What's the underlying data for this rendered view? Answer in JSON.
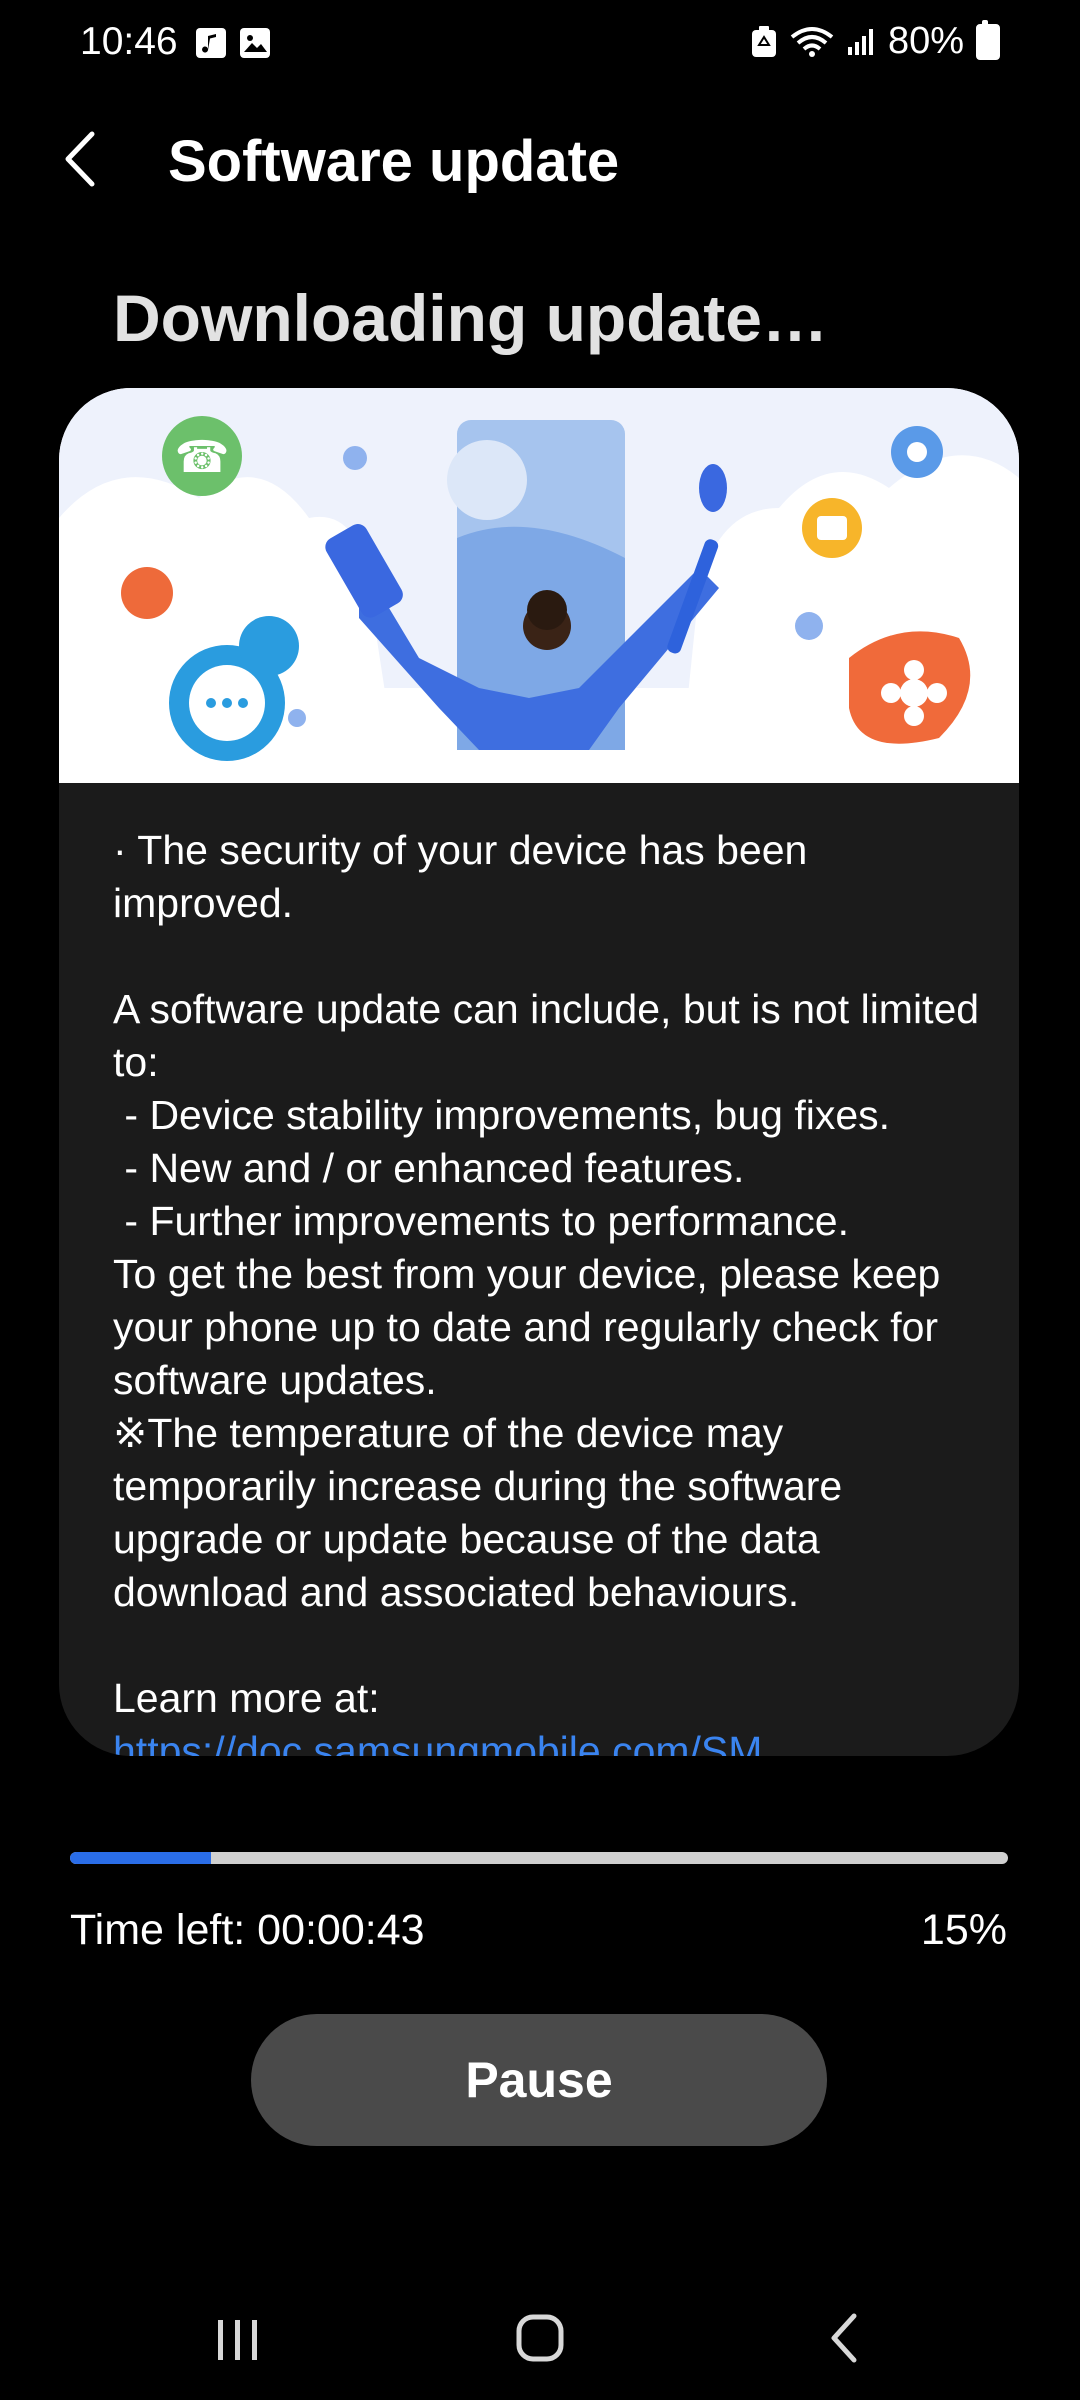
{
  "status_bar": {
    "time": "10:46",
    "battery": "80%",
    "icons": [
      "music-note-icon",
      "gallery-icon",
      "battery-saver-icon",
      "wifi-icon",
      "signal-icon",
      "battery-icon"
    ]
  },
  "app_bar": {
    "title": "Software update",
    "back_icon": "back-arrow-icon"
  },
  "heading": "Downloading update…",
  "release_notes": {
    "intro": "· The security of your device has been improved.",
    "body": "A software update can include, but is not limited to:\n - Device stability improvements, bug fixes.\n - New and / or enhanced features.\n - Further improvements to performance.\nTo get the best from your device, please keep your phone up to date and regularly check for software updates.\n※The temperature of the device may temporarily increase during the software upgrade or update because of the data download and associated behaviours.",
    "learn_more": "Learn more at:",
    "link": "https://doc.samsungmobile.com/SM"
  },
  "download": {
    "progress": 0.15,
    "time_left": "Time left: 00:00:43",
    "percent": "15%"
  },
  "pause_label": "Pause",
  "nav_bar": [
    "recents-icon",
    "home-icon",
    "back-icon"
  ],
  "colors": {
    "background": "#000000",
    "card": "#1b1b1b",
    "progress": "#2a6de8",
    "link": "#3a84f0",
    "button": "#4a4a4a"
  }
}
